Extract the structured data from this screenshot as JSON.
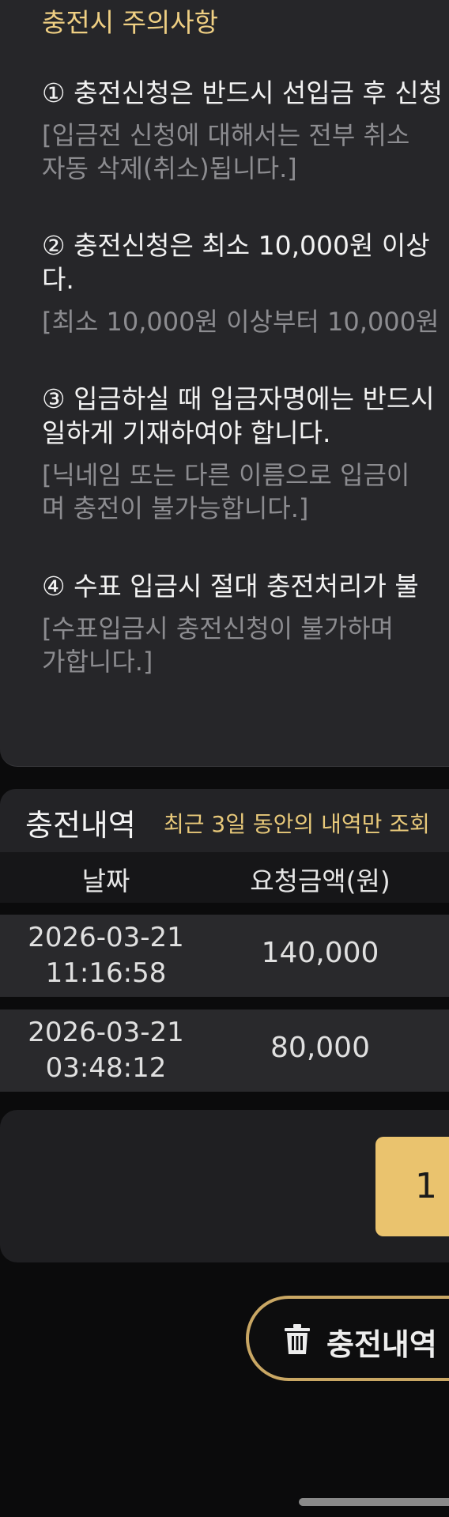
{
  "notice": {
    "heading": "충전시 주의사항",
    "items": [
      {
        "title": "① 충전신청은 반드시 선입금 후 신청",
        "desc": "[입금전 신청에 대해서는 전부 취소\n자동 삭제(취소)됩니다.]"
      },
      {
        "title": "② 충전신청은 최소 10,000원 이상\n다.",
        "desc": "[최소 10,000원 이상부터 10,000원"
      },
      {
        "title": "③ 입금하실 때 입금자명에는 반드시\n일하게 기재하여야 합니다.",
        "desc": "[닉네임 또는 다른 이름으로 입금이\n며 충전이 불가능합니다.]"
      },
      {
        "title": "④ 수표 입금시 절대 충전처리가 불",
        "desc": "[수표입금시 충전신청이 불가하며 \n가합니다.]"
      }
    ]
  },
  "history": {
    "title": "충전내역",
    "subtitle": "최근 3일 동안의 내역만 조회",
    "columns": [
      "날짜",
      "요청금액(원)"
    ],
    "rows": [
      {
        "date": "2026-03-21\n11:16:58",
        "amount": "140,000"
      },
      {
        "date": "2026-03-21\n03:48:12",
        "amount": "80,000"
      }
    ]
  },
  "pagination": {
    "current_page": "1"
  },
  "actions": {
    "delete_history_label": "충전내역"
  },
  "colors": {
    "accent": "#eac36e",
    "panel": "#262629",
    "background": "#0b0b0c"
  },
  "icons": {
    "delete": "trash-icon"
  }
}
